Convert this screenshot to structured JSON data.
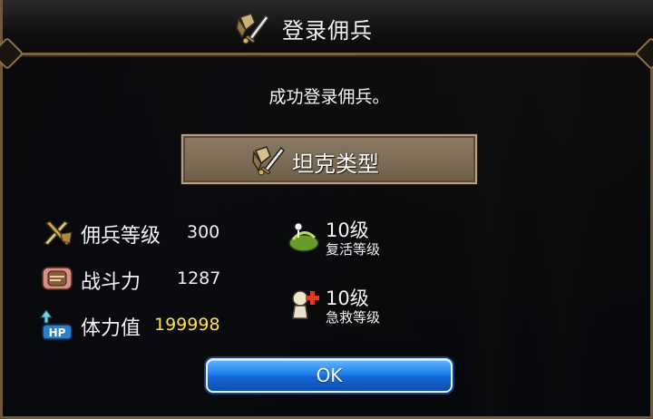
{
  "dialog": {
    "title": "登录佣兵",
    "message": "成功登录佣兵。",
    "type_label": "坦克类型",
    "stats": {
      "level_label": "佣兵等级",
      "level_value": "300",
      "power_label": "战斗力",
      "power_value": "1287",
      "hp_label": "体力值",
      "hp_value": "199998"
    },
    "skills": {
      "revive_level": "10级",
      "revive_name": "复活等级",
      "firstaid_level": "10级",
      "firstaid_name": "急救等级"
    },
    "ok_label": "OK"
  },
  "icons": {
    "title": "mercenary-emblem-icon",
    "type": "tank-class-icon",
    "level": "crossed-swords-icon",
    "power": "combat-power-scroll-icon",
    "hp": "hp-up-icon",
    "revive": "revive-creature-icon",
    "firstaid": "first-aid-icon"
  },
  "colors": {
    "hp_value": "#ffe14a",
    "ok_button": "#1f80ee",
    "frame_gold": "#7a6340",
    "banner_brown": "#7c6b55"
  }
}
